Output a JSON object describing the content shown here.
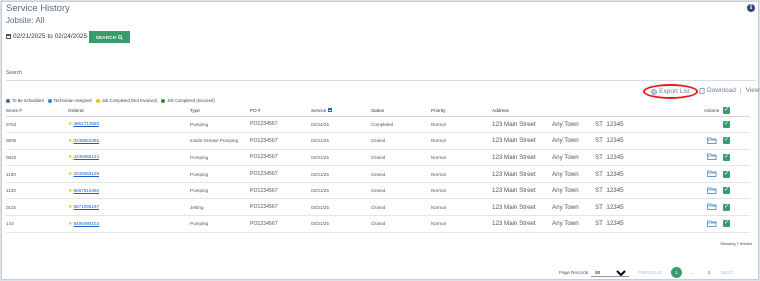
{
  "header": {
    "title": "Service History",
    "jobsite": "Jobsite: All",
    "info_icon": "info-icon"
  },
  "filters": {
    "date_range": "02/21/2025 to 02/24/2025",
    "search_button": "SEARCH",
    "search_label": "Search"
  },
  "actions": {
    "export": "Export List",
    "download": "Download",
    "separator": "|",
    "view": "View"
  },
  "legend": [
    {
      "label": "To Be Scheduled",
      "color": "#3c6fa8"
    },
    {
      "label": "Technician Assigned",
      "color": "#2b8bd1"
    },
    {
      "label": "Job Completed (Not Invoiced)",
      "color": "#f4c400"
    },
    {
      "label": "Job Completed (Invoiced)",
      "color": "#2e8b3a"
    }
  ],
  "table": {
    "headers": [
      "Score #",
      "OrderId",
      "Type",
      "PO #",
      "Service",
      "Status",
      "Priority",
      "Address",
      "",
      "",
      "Actions",
      ""
    ],
    "rows": [
      {
        "score": "0753",
        "order": "4951712550",
        "type": "Pumping",
        "po": "PO1234567",
        "service": "02/24/25",
        "status": "Completed",
        "priority": "Normal",
        "street": "123 Main Street",
        "town": "Any Town",
        "st": "ST",
        "zip": "12345",
        "folder": false
      },
      {
        "score": "0835",
        "order": "0238553385",
        "type": "Inside Grease Pumping",
        "po": "PO1234567",
        "service": "02/21/25",
        "status": "Closed",
        "priority": "Normal",
        "street": "123 Main Street",
        "town": "Any Town",
        "st": "ST",
        "zip": "12345",
        "folder": true
      },
      {
        "score": "0842",
        "order": "4246065124",
        "type": "Pumping",
        "po": "PO1234567",
        "service": "02/21/25",
        "status": "Closed",
        "priority": "Normal",
        "street": "123 Main Street",
        "town": "Any Town",
        "st": "ST",
        "zip": "12345",
        "folder": true
      },
      {
        "score": "1190",
        "order": "4246065125",
        "type": "Pumping",
        "po": "PO1234567",
        "service": "02/21/25",
        "status": "Closed",
        "priority": "Normal",
        "street": "123 Main Street",
        "town": "Any Town",
        "st": "ST",
        "zip": "12345",
        "folder": true
      },
      {
        "score": "1130",
        "order": "6567516468",
        "type": "Pumping",
        "po": "PO1234567",
        "service": "02/21/25",
        "status": "Closed",
        "priority": "Normal",
        "street": "123 Main Street",
        "town": "Any Town",
        "st": "ST",
        "zip": "12345",
        "folder": true
      },
      {
        "score": "0115",
        "order": "5871095197",
        "type": "Jetting",
        "po": "PO1234567",
        "service": "02/21/25",
        "status": "Closed",
        "priority": "Normal",
        "street": "123 Main Street",
        "town": "Any Town",
        "st": "ST",
        "zip": "12345",
        "folder": true
      },
      {
        "score": "143",
        "order": "8495088103",
        "type": "Pumping",
        "po": "PO1234567",
        "service": "02/21/25",
        "status": "Closed",
        "priority": "Normal",
        "street": "123 Main Street",
        "town": "Any Town",
        "st": "ST",
        "zip": "12345",
        "folder": true
      }
    ],
    "showing": "Showing 7 entries"
  },
  "pagination": {
    "label": "Page Records",
    "page_size": "50",
    "previous": "PREVIOUS",
    "current": "1",
    "ellipsis": "...",
    "last": "1",
    "next": "NEXT"
  },
  "colors": {
    "accent_green": "#3b9b6b",
    "link_blue": "#1a5fc7",
    "highlight_red": "#e31c1c"
  }
}
